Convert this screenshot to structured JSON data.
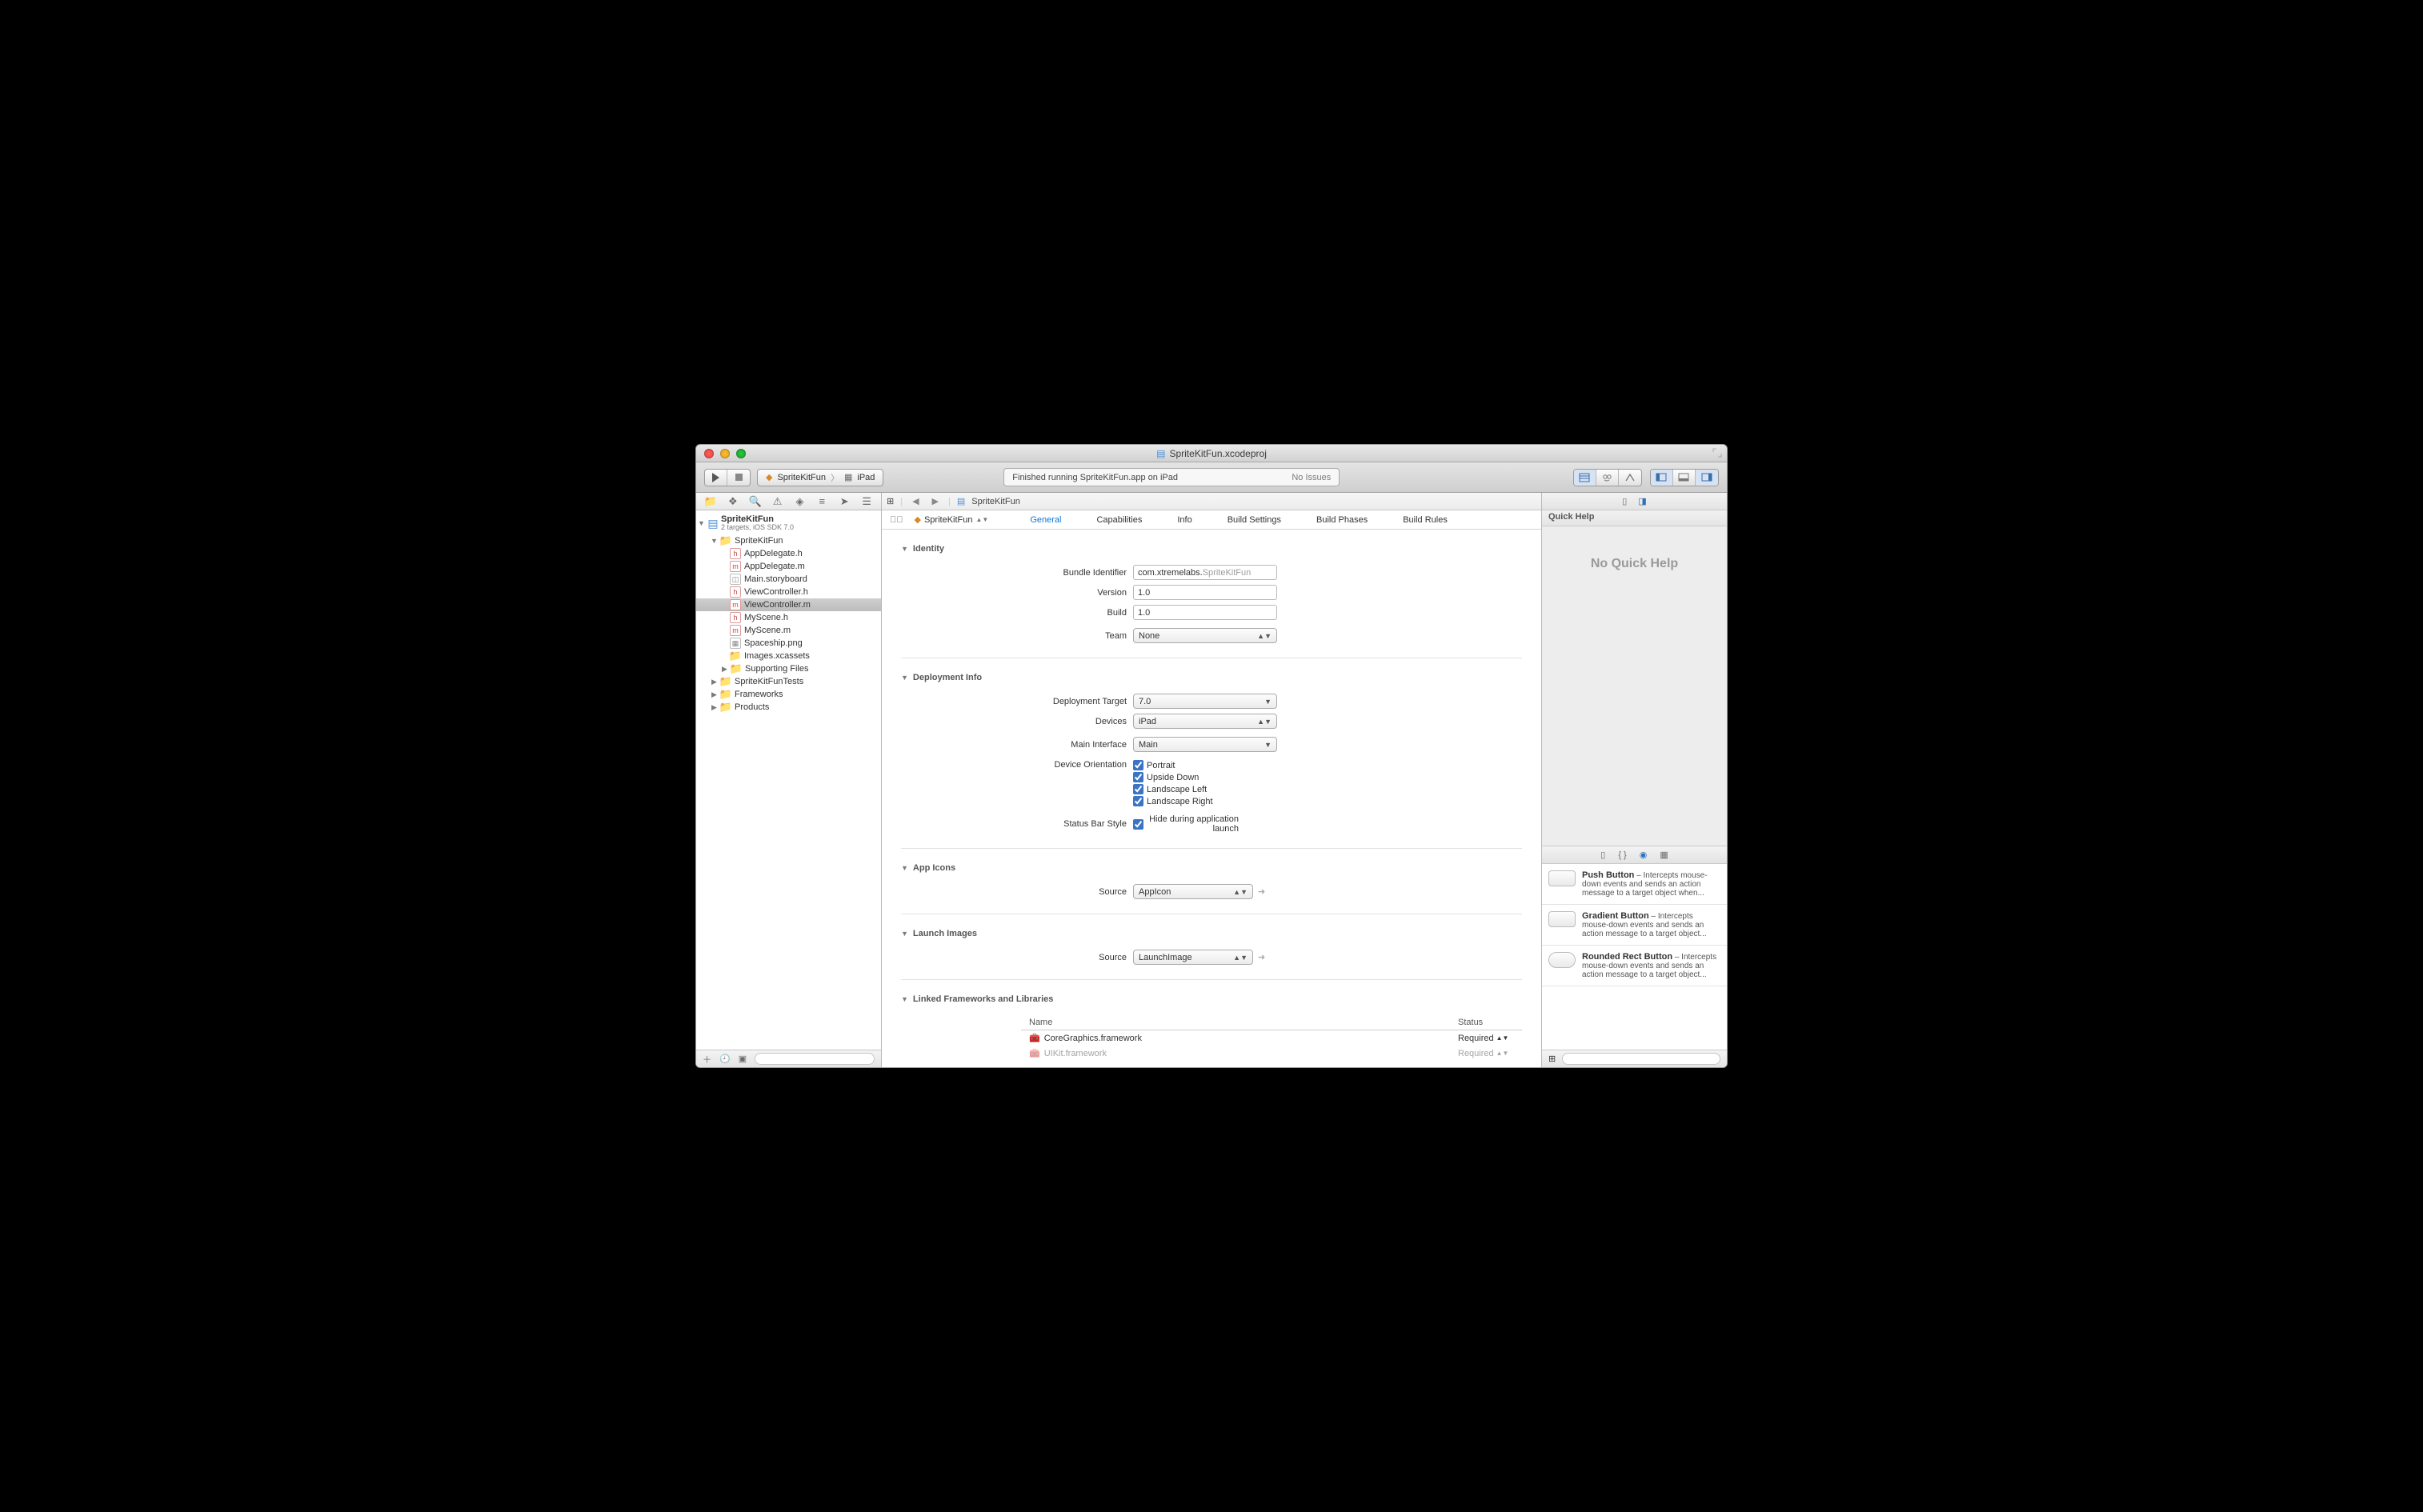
{
  "window": {
    "title": "SpriteKitFun.xcodeproj"
  },
  "toolbar": {
    "scheme_target": "SpriteKitFun",
    "scheme_dest": "iPad",
    "activity_msg": "Finished running SpriteKitFun.app on iPad",
    "activity_status": "No Issues"
  },
  "navigator": {
    "project": {
      "name": "SpriteKitFun",
      "sub": "2 targets, iOS SDK 7.0"
    },
    "tree": {
      "group1": "SpriteKitFun",
      "files": {
        "appdelegate_h": "AppDelegate.h",
        "appdelegate_m": "AppDelegate.m",
        "main_sb": "Main.storyboard",
        "vc_h": "ViewController.h",
        "vc_m": "ViewController.m",
        "myscene_h": "MyScene.h",
        "myscene_m": "MyScene.m",
        "spaceship": "Spaceship.png",
        "assets": "Images.xcassets",
        "supporting": "Supporting Files"
      },
      "tests": "SpriteKitFunTests",
      "frameworks": "Frameworks",
      "products": "Products"
    }
  },
  "jumpbar": {
    "item": "SpriteKitFun"
  },
  "target_picker": {
    "name": "SpriteKitFun"
  },
  "tabs": {
    "general": "General",
    "capabilities": "Capabilities",
    "info": "Info",
    "build_settings": "Build Settings",
    "build_phases": "Build Phases",
    "build_rules": "Build Rules"
  },
  "sections": {
    "identity": "Identity",
    "deployment": "Deployment Info",
    "appicons": "App Icons",
    "launch": "Launch Images",
    "linked": "Linked Frameworks and Libraries"
  },
  "identity": {
    "bundle_label": "Bundle Identifier",
    "bundle_prefix": "com.xtremelabs.",
    "bundle_suffix": "SpriteKitFun",
    "version_label": "Version",
    "version": "1.0",
    "build_label": "Build",
    "build": "1.0",
    "team_label": "Team",
    "team": "None"
  },
  "deployment": {
    "target_label": "Deployment Target",
    "target": "7.0",
    "devices_label": "Devices",
    "devices": "iPad",
    "main_if_label": "Main Interface",
    "main_if": "Main",
    "orient_label": "Device Orientation",
    "orient": {
      "portrait": "Portrait",
      "upside": "Upside Down",
      "ll": "Landscape Left",
      "lr": "Landscape Right"
    },
    "status_label": "Status Bar Style",
    "status_chk": "Hide during application launch"
  },
  "appicons": {
    "source_label": "Source",
    "source": "AppIcon"
  },
  "launch": {
    "source_label": "Source",
    "source": "LaunchImage"
  },
  "linked": {
    "col_name": "Name",
    "col_status": "Status",
    "rows": [
      {
        "name": "CoreGraphics.framework",
        "status": "Required"
      },
      {
        "name": "UIKit.framework",
        "status": "Required"
      }
    ]
  },
  "inspector": {
    "quickhelp_label": "Quick Help",
    "noqh": "No Quick Help",
    "library": [
      {
        "title": "Push Button",
        "desc": " – Intercepts mouse-down events and sends an action message to a target object when...",
        "shape": "rect"
      },
      {
        "title": "Gradient Button",
        "desc": " – Intercepts mouse-down events and sends an action message to a target object...",
        "shape": "rect"
      },
      {
        "title": "Rounded Rect Button",
        "desc": " – Intercepts mouse-down events and sends an action message to a target object...",
        "shape": "round"
      }
    ]
  }
}
